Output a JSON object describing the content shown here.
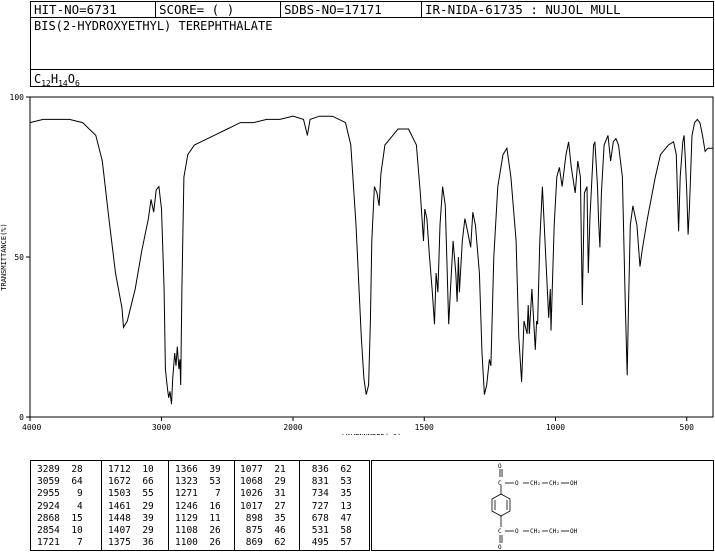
{
  "header": {
    "hit_no": "HIT-NO=6731",
    "score": "SCORE=  (   )",
    "sdbs_no": "SDBS-NO=17171",
    "ir_nida": "IR-NIDA-61735 : NUJOL MULL",
    "compound_name": "BIS(2-HYDROXYETHYL) TEREPHTHALATE",
    "formula": {
      "c": "C",
      "c_n": "12",
      "h": "H",
      "h_n": "14",
      "o": "O",
      "o_n": "6"
    }
  },
  "chart_data": {
    "type": "line",
    "title": "",
    "xlabel": "WAVENUMBER(-1)",
    "ylabel": "TRANSMITTANCE(%)",
    "xlim": [
      4000,
      400
    ],
    "ylim": [
      0,
      100
    ],
    "x_ticks": [
      "4000",
      "3000",
      "2000",
      "1500",
      "1000",
      "500"
    ],
    "y_ticks": [
      "0",
      "50",
      "100"
    ],
    "series": [
      {
        "points": [
          [
            4000,
            92
          ],
          [
            3900,
            93
          ],
          [
            3800,
            93
          ],
          [
            3700,
            93
          ],
          [
            3600,
            92
          ],
          [
            3500,
            88
          ],
          [
            3450,
            80
          ],
          [
            3400,
            62
          ],
          [
            3350,
            45
          ],
          [
            3300,
            34
          ],
          [
            3289,
            28
          ],
          [
            3260,
            30
          ],
          [
            3200,
            40
          ],
          [
            3150,
            52
          ],
          [
            3100,
            62
          ],
          [
            3080,
            68
          ],
          [
            3059,
            64
          ],
          [
            3040,
            71
          ],
          [
            3020,
            72
          ],
          [
            3000,
            65
          ],
          [
            2980,
            40
          ],
          [
            2970,
            15
          ],
          [
            2955,
            9
          ],
          [
            2945,
            6
          ],
          [
            2935,
            8
          ],
          [
            2924,
            4
          ],
          [
            2915,
            12
          ],
          [
            2900,
            20
          ],
          [
            2890,
            16
          ],
          [
            2880,
            22
          ],
          [
            2868,
            15
          ],
          [
            2860,
            18
          ],
          [
            2854,
            10
          ],
          [
            2845,
            40
          ],
          [
            2830,
            75
          ],
          [
            2800,
            82
          ],
          [
            2750,
            85
          ],
          [
            2700,
            86
          ],
          [
            2600,
            88
          ],
          [
            2500,
            90
          ],
          [
            2400,
            92
          ],
          [
            2300,
            92
          ],
          [
            2200,
            93
          ],
          [
            2100,
            93
          ],
          [
            2000,
            94
          ],
          [
            1960,
            93
          ],
          [
            1945,
            88
          ],
          [
            1935,
            93
          ],
          [
            1900,
            94
          ],
          [
            1850,
            94
          ],
          [
            1800,
            92
          ],
          [
            1780,
            85
          ],
          [
            1760,
            60
          ],
          [
            1740,
            25
          ],
          [
            1730,
            12
          ],
          [
            1721,
            7
          ],
          [
            1712,
            10
          ],
          [
            1705,
            30
          ],
          [
            1700,
            55
          ],
          [
            1690,
            72
          ],
          [
            1680,
            70
          ],
          [
            1672,
            66
          ],
          [
            1665,
            76
          ],
          [
            1650,
            85
          ],
          [
            1620,
            88
          ],
          [
            1600,
            90
          ],
          [
            1560,
            90
          ],
          [
            1530,
            85
          ],
          [
            1515,
            70
          ],
          [
            1503,
            55
          ],
          [
            1498,
            65
          ],
          [
            1490,
            62
          ],
          [
            1480,
            50
          ],
          [
            1470,
            40
          ],
          [
            1461,
            29
          ],
          [
            1455,
            45
          ],
          [
            1448,
            39
          ],
          [
            1440,
            60
          ],
          [
            1430,
            72
          ],
          [
            1420,
            66
          ],
          [
            1407,
            29
          ],
          [
            1400,
            40
          ],
          [
            1390,
            55
          ],
          [
            1380,
            45
          ],
          [
            1375,
            36
          ],
          [
            1370,
            50
          ],
          [
            1366,
            39
          ],
          [
            1355,
            55
          ],
          [
            1345,
            62
          ],
          [
            1335,
            58
          ],
          [
            1323,
            53
          ],
          [
            1315,
            64
          ],
          [
            1305,
            60
          ],
          [
            1290,
            45
          ],
          [
            1280,
            20
          ],
          [
            1271,
            7
          ],
          [
            1262,
            10
          ],
          [
            1252,
            18
          ],
          [
            1246,
            16
          ],
          [
            1235,
            50
          ],
          [
            1220,
            72
          ],
          [
            1200,
            82
          ],
          [
            1185,
            84
          ],
          [
            1170,
            75
          ],
          [
            1150,
            55
          ],
          [
            1140,
            25
          ],
          [
            1129,
            11
          ],
          [
            1120,
            30
          ],
          [
            1108,
            26
          ],
          [
            1104,
            35
          ],
          [
            1100,
            26
          ],
          [
            1090,
            40
          ],
          [
            1077,
            21
          ],
          [
            1072,
            30
          ],
          [
            1068,
            29
          ],
          [
            1060,
            55
          ],
          [
            1050,
            72
          ],
          [
            1040,
            55
          ],
          [
            1026,
            31
          ],
          [
            1020,
            40
          ],
          [
            1017,
            27
          ],
          [
            1005,
            60
          ],
          [
            995,
            75
          ],
          [
            985,
            78
          ],
          [
            975,
            72
          ],
          [
            960,
            82
          ],
          [
            950,
            86
          ],
          [
            940,
            78
          ],
          [
            925,
            70
          ],
          [
            915,
            80
          ],
          [
            905,
            75
          ],
          [
            898,
            35
          ],
          [
            890,
            70
          ],
          [
            880,
            72
          ],
          [
            875,
            45
          ],
          [
            869,
            62
          ],
          [
            855,
            85
          ],
          [
            850,
            86
          ],
          [
            840,
            72
          ],
          [
            836,
            62
          ],
          [
            831,
            53
          ],
          [
            825,
            70
          ],
          [
            815,
            85
          ],
          [
            800,
            88
          ],
          [
            790,
            80
          ],
          [
            780,
            86
          ],
          [
            770,
            87
          ],
          [
            760,
            85
          ],
          [
            745,
            75
          ],
          [
            734,
            35
          ],
          [
            727,
            13
          ],
          [
            722,
            35
          ],
          [
            715,
            60
          ],
          [
            705,
            66
          ],
          [
            690,
            60
          ],
          [
            678,
            47
          ],
          [
            670,
            52
          ],
          [
            650,
            62
          ],
          [
            620,
            75
          ],
          [
            600,
            82
          ],
          [
            570,
            85
          ],
          [
            550,
            86
          ],
          [
            540,
            82
          ],
          [
            531,
            58
          ],
          [
            525,
            75
          ],
          [
            515,
            86
          ],
          [
            510,
            88
          ],
          [
            505,
            80
          ],
          [
            500,
            70
          ],
          [
            495,
            57
          ],
          [
            490,
            65
          ],
          [
            480,
            88
          ],
          [
            470,
            92
          ],
          [
            460,
            93
          ],
          [
            450,
            92
          ],
          [
            440,
            88
          ],
          [
            430,
            83
          ],
          [
            420,
            84
          ],
          [
            400,
            84
          ]
        ]
      }
    ]
  },
  "peak_table": {
    "columns": [
      [
        "3289  28",
        "3059  64",
        "2955   9",
        "2924   4",
        "2868  15",
        "2854  10",
        "1721   7"
      ],
      [
        "1712  10",
        "1672  66",
        "1503  55",
        "1461  29",
        "1448  39",
        "1407  29",
        "1375  36"
      ],
      [
        "1366  39",
        "1323  53",
        "1271   7",
        "1246  16",
        "1129  11",
        "1108  26",
        "1100  26"
      ],
      [
        "1077  21",
        "1068  29",
        "1026  31",
        "1017  27",
        " 898  35",
        " 875  46",
        " 869  62"
      ],
      [
        " 836  62",
        " 831  53",
        " 734  35",
        " 727  13",
        " 678  47",
        " 531  58",
        " 495  57"
      ]
    ]
  },
  "structure": {
    "o_label": "O",
    "ester_o_label": "O",
    "ch2_label": "CH₂",
    "oh_label": "OH"
  }
}
